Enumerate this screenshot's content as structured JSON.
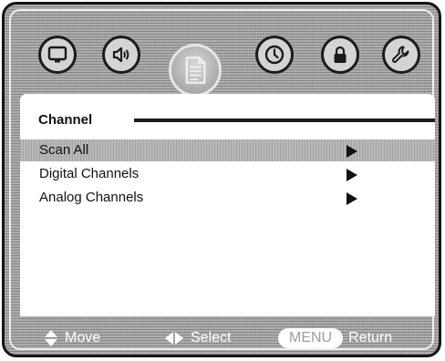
{
  "menu_icons": [
    {
      "name": "picture",
      "icon": "tv-icon"
    },
    {
      "name": "audio",
      "icon": "speaker-icon"
    },
    {
      "name": "channel",
      "icon": "document-icon",
      "selected": true
    },
    {
      "name": "time",
      "icon": "clock-icon"
    },
    {
      "name": "lock",
      "icon": "lock-icon"
    },
    {
      "name": "setup",
      "icon": "wrench-icon"
    }
  ],
  "panel": {
    "title": "Channel",
    "items": [
      {
        "label": "Scan All",
        "selected": true
      },
      {
        "label": "Digital Channels",
        "selected": false
      },
      {
        "label": "Analog Channels",
        "selected": false
      }
    ]
  },
  "footer": {
    "move_label": "Move",
    "select_label": "Select",
    "menu_key": "MENU",
    "return_label": "Return"
  },
  "colors": {
    "frame": "#a9a9a9",
    "panel": "#ffffff",
    "highlight": "#b9b9b9",
    "text": "#111111"
  }
}
